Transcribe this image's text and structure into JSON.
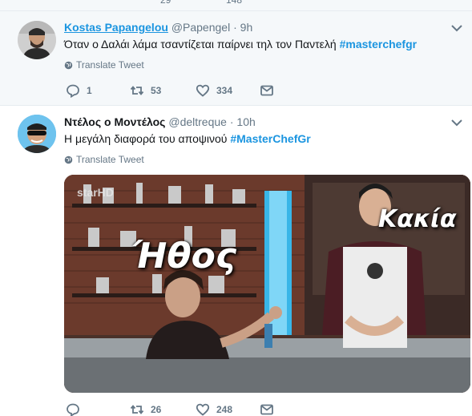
{
  "top_strip": {
    "retweets": "29",
    "likes": "148"
  },
  "tweets": [
    {
      "name": "Kostas Papangelou",
      "handle": "@Papengel",
      "time": "9h",
      "text": "Όταν ο Δαλάι λάμα τσαντίζεται παίρνει τηλ τον Παντελή",
      "hashtag": "#masterchefgr",
      "translate": "Translate Tweet",
      "replies": "1",
      "retweets": "53",
      "likes": "334"
    },
    {
      "name": "Ντέλος ο Μοντέλος",
      "handle": "@deltreque",
      "time": "10h",
      "text": "Η μεγάλη διαφορά του αποψινού",
      "hashtag": "#MasterChefGr",
      "translate": "Translate Tweet",
      "media": {
        "caption_left": "Ήθος",
        "caption_right": "Κακία",
        "channel_logo": "starHD"
      },
      "replies": "",
      "retweets": "26",
      "likes": "248"
    }
  ],
  "colors": {
    "link": "#1b95e0",
    "muted": "#657786",
    "text": "#14171a"
  },
  "icons": [
    "reply-icon",
    "retweet-icon",
    "like-icon",
    "dm-icon",
    "chevron-down-icon",
    "globe-icon"
  ]
}
